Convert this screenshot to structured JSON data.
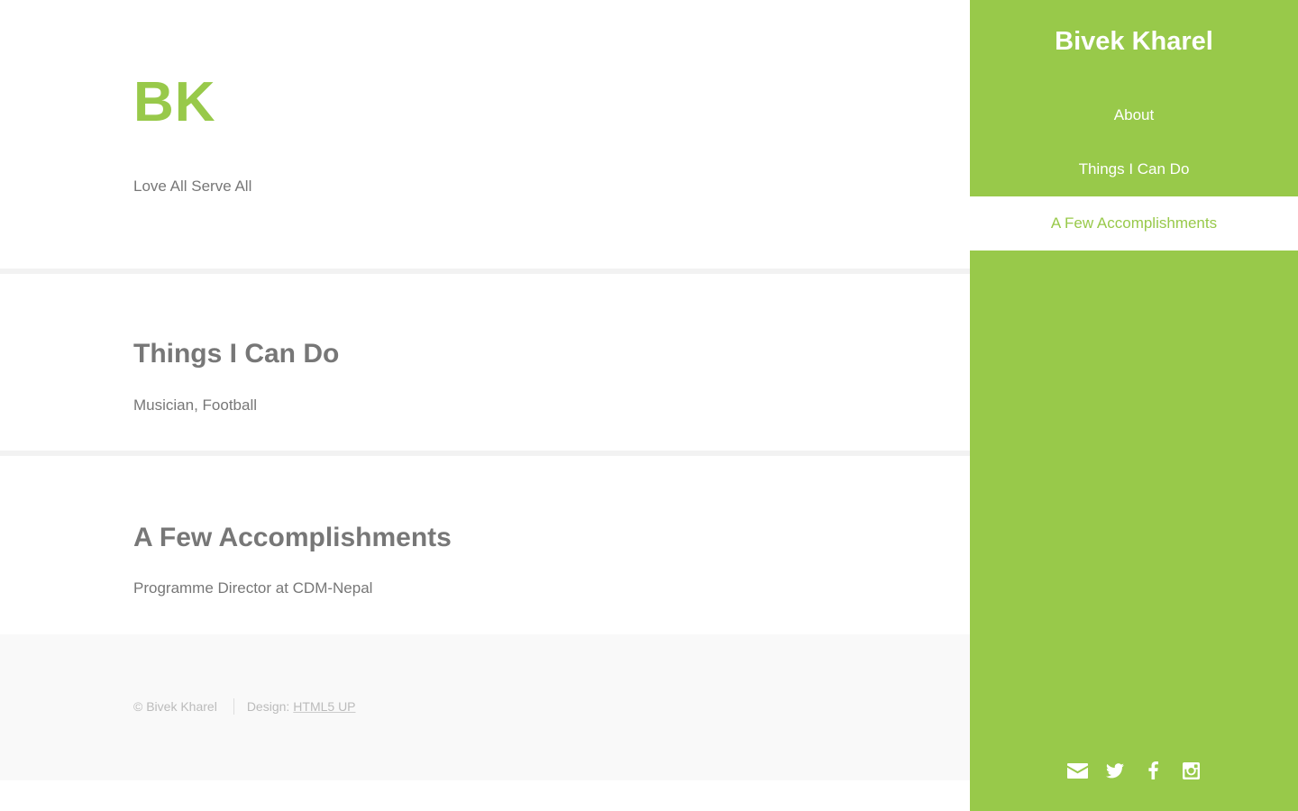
{
  "intro": {
    "logo": "BK",
    "tagline": "Love All Serve All"
  },
  "things": {
    "heading": "Things I Can Do",
    "text": "Musician, Football"
  },
  "accomplishments": {
    "heading": "A Few Accomplishments",
    "text": "Programme Director at CDM-Nepal"
  },
  "footer": {
    "copyright": "© Bivek Kharel",
    "design_label": "Design:",
    "design_link": "HTML5 UP"
  },
  "sidebar": {
    "name": "Bivek Kharel",
    "nav": [
      {
        "label": "About",
        "active": false
      },
      {
        "label": "Things I Can Do",
        "active": false
      },
      {
        "label": "A Few Accomplishments",
        "active": true
      }
    ],
    "social_icons": [
      "envelope-icon",
      "twitter-icon",
      "facebook-icon",
      "instagram-icon"
    ]
  },
  "colors": {
    "accent": "#98c94a",
    "text": "#777777",
    "footer_bg": "#f9f9f9",
    "divider": "#f2f2f2"
  }
}
